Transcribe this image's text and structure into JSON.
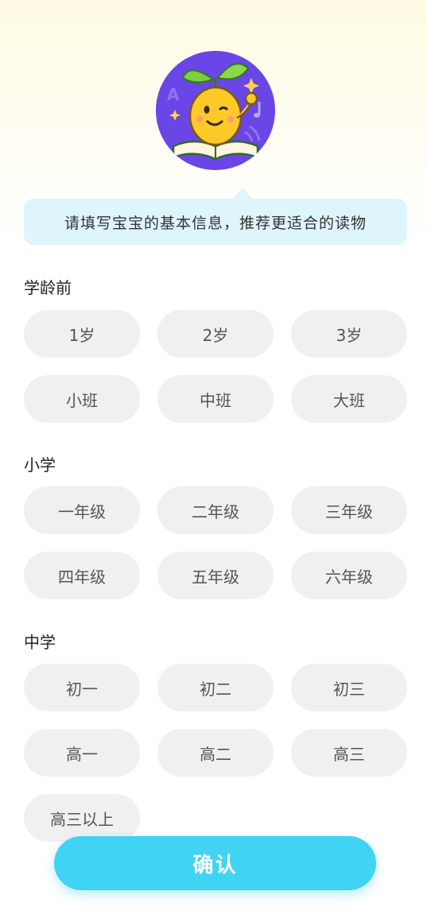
{
  "tip_text": "请填写宝宝的基本信息，推荐更适合的读物",
  "sections": [
    {
      "title": "学龄前",
      "options": [
        "1岁",
        "2岁",
        "3岁",
        "小班",
        "中班",
        "大班"
      ]
    },
    {
      "title": "小学",
      "options": [
        "一年级",
        "二年级",
        "三年级",
        "四年级",
        "五年级",
        "六年级"
      ]
    },
    {
      "title": "中学",
      "options": [
        "初一",
        "初二",
        "初三",
        "高一",
        "高二",
        "高三",
        "高三以上"
      ]
    }
  ],
  "confirm_label": "确认",
  "colors": {
    "accent": "#40d4f4",
    "chip_bg": "#f0f0f0",
    "tip_bg": "#def5fc",
    "avatar_bg": "#6a46e6"
  },
  "mascot_icon": "sprout-reading-mascot-icon"
}
